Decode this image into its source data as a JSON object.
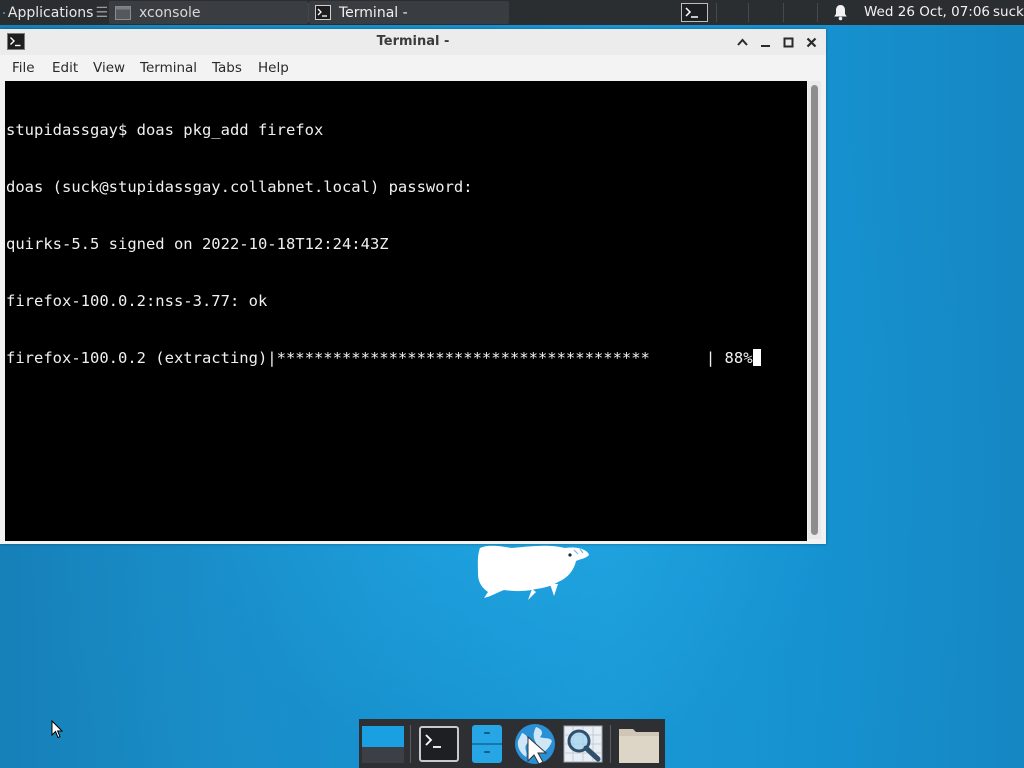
{
  "top_panel": {
    "applications_label": "Applications",
    "tasks": [
      {
        "label": "xconsole"
      },
      {
        "label": "Terminal -"
      }
    ],
    "clock": "Wed 26 Oct, 07:06",
    "user": "suck"
  },
  "window": {
    "title": "Terminal -",
    "menu": [
      "File",
      "Edit",
      "View",
      "Terminal",
      "Tabs",
      "Help"
    ],
    "terminal_lines": [
      "stupidassgay$ doas pkg_add firefox",
      "doas (suck@stupidassgay.collabnet.local) password:",
      "quirks-5.5 signed on 2022-10-18T12:24:43Z",
      "firefox-100.0.2:nss-3.77: ok",
      "firefox-100.0.2 (extracting)|****************************************      | 88%"
    ],
    "progress_percent": 88
  },
  "dock": {
    "items": [
      "show-desktop",
      "terminal",
      "file-manager",
      "web-browser",
      "app-finder",
      "home-folder"
    ]
  },
  "colors": {
    "panel_bg": "#2b2e31",
    "desktop_blue": "#1a8cc6",
    "terminal_bg": "#000000",
    "terminal_fg": "#f0f0f0"
  }
}
